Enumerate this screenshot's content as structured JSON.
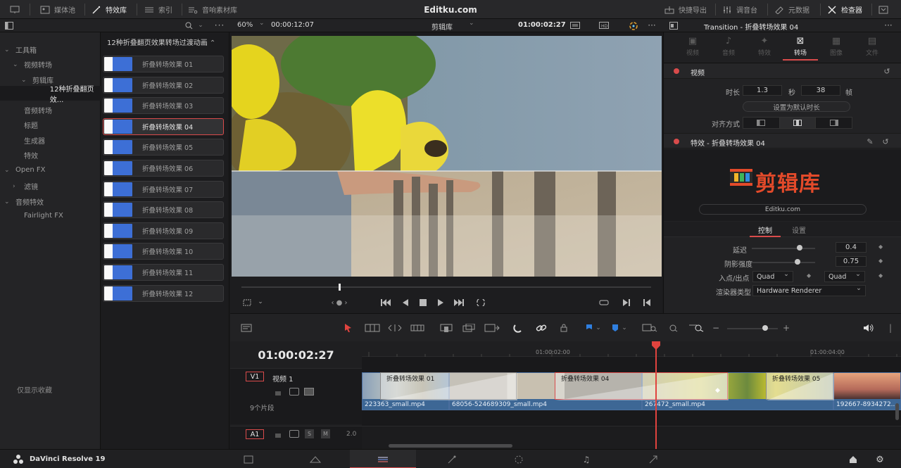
{
  "topbar": {
    "items": [
      {
        "label": "媒体池",
        "icon": "media-pool-icon"
      },
      {
        "label": "特效库",
        "icon": "effects-icon",
        "active": true
      },
      {
        "label": "索引",
        "icon": "index-icon"
      },
      {
        "label": "音响素材库",
        "icon": "sound-library-icon"
      }
    ],
    "title": "Editku.com",
    "right_items": [
      {
        "label": "快捷导出",
        "icon": "quick-export-icon"
      },
      {
        "label": "调音台",
        "icon": "mixer-icon"
      },
      {
        "label": "元数据",
        "icon": "metadata-icon"
      },
      {
        "label": "检查器",
        "icon": "inspector-icon",
        "active": true
      }
    ]
  },
  "viewer_bar": {
    "zoom": "60%",
    "source_timecode": "00:00:12:07",
    "timeline_name": "剪辑库",
    "timecode": "01:00:02:27",
    "inspector_title": "Transition - 折叠转场效果 04"
  },
  "tree": {
    "items": [
      {
        "label": "工具箱",
        "level": 0,
        "arrow": "⌄"
      },
      {
        "label": "视频转场",
        "level": 1,
        "arrow": "⌄"
      },
      {
        "label": "剪辑库",
        "level": 2,
        "arrow": "⌄"
      },
      {
        "label": "12种折叠翻页效...",
        "level": 3,
        "selected": true
      },
      {
        "label": "音频转场",
        "level": 1
      },
      {
        "label": "标题",
        "level": 1
      },
      {
        "label": "生成器",
        "level": 1
      },
      {
        "label": "特效",
        "level": 1
      },
      {
        "label": "Open FX",
        "level": 0,
        "arrow": "⌄"
      },
      {
        "label": "滤镜",
        "level": 1,
        "arrow": "›"
      },
      {
        "label": "音频特效",
        "level": 0,
        "arrow": "⌄"
      },
      {
        "label": "Fairlight FX",
        "level": 1
      }
    ],
    "favorites_label": "仅显示收藏"
  },
  "fx_list": {
    "header": "12种折叠翻页效果转场过渡动画",
    "items": [
      "折叠转场效果 01",
      "折叠转场效果 02",
      "折叠转场效果 03",
      "折叠转场效果 04",
      "折叠转场效果 05",
      "折叠转场效果 06",
      "折叠转场效果 07",
      "折叠转场效果 08",
      "折叠转场效果 09",
      "折叠转场效果 10",
      "折叠转场效果 11",
      "折叠转场效果 12"
    ],
    "selected_index": 3
  },
  "inspector": {
    "tabs": [
      {
        "label": "视频",
        "icon": "video-tab-icon"
      },
      {
        "label": "音频",
        "icon": "audio-tab-icon"
      },
      {
        "label": "特效",
        "icon": "effects-tab-icon"
      },
      {
        "label": "转场",
        "icon": "transition-tab-icon",
        "active": true
      },
      {
        "label": "图像",
        "icon": "image-tab-icon"
      },
      {
        "label": "文件",
        "icon": "file-tab-icon"
      }
    ],
    "video_section": "视频",
    "duration_label": "时长",
    "duration_seconds": "1.3",
    "seconds_unit": "秒",
    "duration_frames": "38",
    "frames_unit": "帧",
    "set_default_button": "设置为默认时长",
    "alignment_label": "对齐方式",
    "effect_section": "特效 - 折叠转场效果 04",
    "logo_text": "剪辑库",
    "logo_url": "Editku.com",
    "subtabs": [
      "控制",
      "设置"
    ],
    "params": {
      "delay_label": "延迟",
      "delay_value": "0.4",
      "delay_level": 0.75,
      "shadow_label": "阴影强度",
      "shadow_value": "0.75",
      "shadow_level": 0.72,
      "easing_label": "入点/出点",
      "ease_in": "Quad",
      "ease_out": "Quad",
      "renderer_label": "渲染器类型",
      "renderer_value": "Hardware Renderer"
    }
  },
  "timeline": {
    "timecode": "01:00:02:27",
    "ruler_labels": [
      "01:00:02:00",
      "01:00:04:00"
    ],
    "v1_label": "V1",
    "v1_name": "视频 1",
    "v1_clips_count": "9个片段",
    "a1_label": "A1",
    "a1_level": "2.0",
    "clips": [
      {
        "name": "223363_small.mp4"
      },
      {
        "name": "68056-524689309_small.mp4"
      },
      {
        "name": "267472_small.mp4"
      },
      {
        "name": "192667-8934272..."
      }
    ],
    "transitions": [
      "折叠转场效果 01",
      "折叠转场效果 04",
      "折叠转场效果 05"
    ]
  },
  "bottombar": {
    "app_name": "DaVinci Resolve 19"
  },
  "colors": {
    "accent_red": "#d94b4b",
    "clip_blue": "#3d6795",
    "playhead": "#e0433e"
  }
}
